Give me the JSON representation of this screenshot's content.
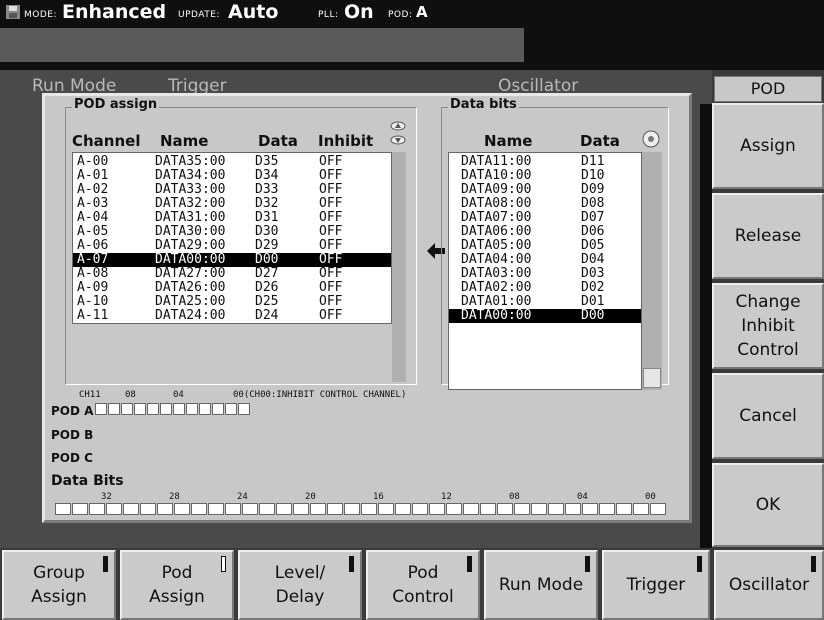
{
  "status": {
    "mode_label": "MODE:",
    "mode_value": "Enhanced",
    "update_label": "UPDATE:",
    "update_value": "Auto",
    "pll_label": "PLL:",
    "pll_value": "On",
    "pod_label": "POD:",
    "pod_value": "A"
  },
  "background_tabs": [
    "Run Mode",
    "Trigger",
    "Oscillator"
  ],
  "pod_assign": {
    "title": "POD assign",
    "headers": {
      "channel": "Channel",
      "name": "Name",
      "data": "Data",
      "inhibit": "Inhibit"
    },
    "rows": [
      {
        "channel": "A-00",
        "name": "DATA35:00",
        "data": "D35",
        "inhibit": "OFF"
      },
      {
        "channel": "A-01",
        "name": "DATA34:00",
        "data": "D34",
        "inhibit": "OFF"
      },
      {
        "channel": "A-02",
        "name": "DATA33:00",
        "data": "D33",
        "inhibit": "OFF"
      },
      {
        "channel": "A-03",
        "name": "DATA32:00",
        "data": "D32",
        "inhibit": "OFF"
      },
      {
        "channel": "A-04",
        "name": "DATA31:00",
        "data": "D31",
        "inhibit": "OFF"
      },
      {
        "channel": "A-05",
        "name": "DATA30:00",
        "data": "D30",
        "inhibit": "OFF"
      },
      {
        "channel": "A-06",
        "name": "DATA29:00",
        "data": "D29",
        "inhibit": "OFF"
      },
      {
        "channel": "A-07",
        "name": "DATA00:00",
        "data": "D00",
        "inhibit": "OFF",
        "selected": true
      },
      {
        "channel": "A-08",
        "name": "DATA27:00",
        "data": "D27",
        "inhibit": "OFF"
      },
      {
        "channel": "A-09",
        "name": "DATA26:00",
        "data": "D26",
        "inhibit": "OFF"
      },
      {
        "channel": "A-10",
        "name": "DATA25:00",
        "data": "D25",
        "inhibit": "OFF"
      },
      {
        "channel": "A-11",
        "name": "DATA24:00",
        "data": "D24",
        "inhibit": "OFF"
      }
    ]
  },
  "data_bits": {
    "title": "Data bits",
    "headers": {
      "name": "Name",
      "data": "Data"
    },
    "rows": [
      {
        "name": "DATA11:00",
        "data": "D11"
      },
      {
        "name": "DATA10:00",
        "data": "D10"
      },
      {
        "name": "DATA09:00",
        "data": "D09"
      },
      {
        "name": "DATA08:00",
        "data": "D08"
      },
      {
        "name": "DATA07:00",
        "data": "D07"
      },
      {
        "name": "DATA06:00",
        "data": "D06"
      },
      {
        "name": "DATA05:00",
        "data": "D05"
      },
      {
        "name": "DATA04:00",
        "data": "D04"
      },
      {
        "name": "DATA03:00",
        "data": "D03"
      },
      {
        "name": "DATA02:00",
        "data": "D02"
      },
      {
        "name": "DATA01:00",
        "data": "D01"
      },
      {
        "name": "DATA00:00",
        "data": "D00",
        "selected": true
      }
    ]
  },
  "pod_map": {
    "ticks": [
      "CH11",
      "08",
      "04",
      "00(CH00:INHIBIT CONTROL CHANNEL)"
    ],
    "pod_a": "POD A",
    "pod_b": "POD B",
    "pod_c": "POD C",
    "data_bits_label": "Data Bits",
    "bit_ticks": [
      "32",
      "28",
      "24",
      "20",
      "16",
      "12",
      "08",
      "04",
      "00"
    ]
  },
  "right_menu": {
    "title": "POD",
    "buttons": [
      "Assign",
      "Release",
      "Change Inhibit Control",
      "Cancel",
      "OK"
    ]
  },
  "bottom_menu": [
    {
      "label": "Group Assign"
    },
    {
      "label": "Pod Assign"
    },
    {
      "label": "Level/ Delay"
    },
    {
      "label": "Pod Control"
    },
    {
      "label": "Run Mode"
    },
    {
      "label": "Trigger"
    },
    {
      "label": "Oscillator"
    }
  ],
  "icons": {
    "transfer_arrow": "arrow-left-icon",
    "scroll_updown": "scroll-updown-icon",
    "scroll_single": "scroll-circle-icon"
  }
}
